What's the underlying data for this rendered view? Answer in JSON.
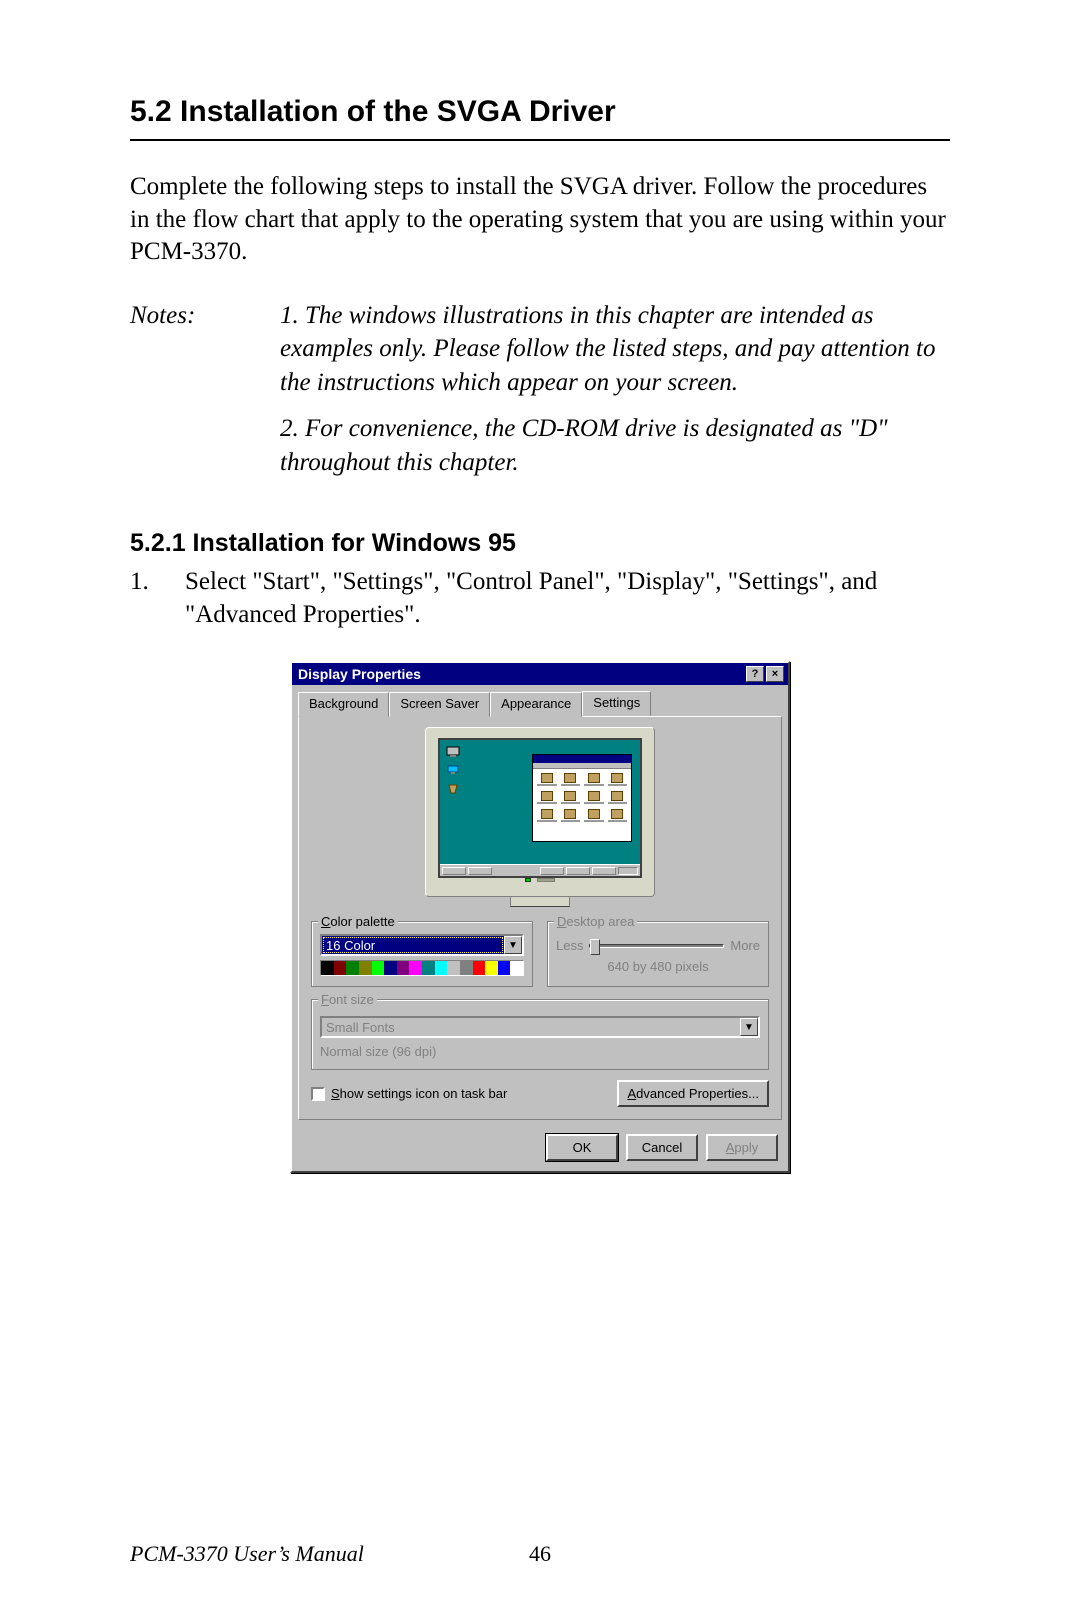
{
  "section": {
    "number": "5.2",
    "title": "5.2  Installation of the SVGA Driver"
  },
  "intro": "Complete the following steps to install the SVGA driver. Follow the procedures in the flow chart that apply to the operating system that you are using within your PCM-3370.",
  "notes": {
    "label": "Notes:",
    "item1": "1.  The windows illustrations in this chapter are intended as examples only. Please follow the listed steps, and pay attention to the instructions which appear on your screen.",
    "item2": "2.  For convenience, the CD-ROM drive is designated as \"D\" throughout this chapter."
  },
  "subsection": {
    "title": "5.2.1 Installation for Windows 95"
  },
  "step1": {
    "num": "1.",
    "text": "Select \"Start\", \"Settings\", \"Control Panel\", \"Display\", \"Settings\", and \"Advanced Properties\"."
  },
  "dialog": {
    "title": "Display Properties",
    "help": "?",
    "close": "×",
    "tabs": {
      "background": "Background",
      "screensaver": "Screen Saver",
      "appearance": "Appearance",
      "settings": "Settings"
    },
    "colorPalette": {
      "legend": "Color palette",
      "value": "16 Color"
    },
    "desktopArea": {
      "legend": "Desktop area",
      "less": "Less",
      "more": "More",
      "resolution": "640 by 480 pixels"
    },
    "fontSize": {
      "legend": "Font size",
      "value": "Small Fonts",
      "normal": "Normal size (96 dpi)"
    },
    "showSettings": "Show settings icon on task bar",
    "advanced": "Advanced Properties...",
    "buttons": {
      "ok": "OK",
      "cancel": "Cancel",
      "apply": "Apply"
    }
  },
  "palette_colors": [
    "#000000",
    "#800000",
    "#008000",
    "#808000",
    "#00ff00",
    "#000080",
    "#800080",
    "#ff00ff",
    "#008080",
    "#00ffff",
    "#c0c0c0",
    "#808080",
    "#ff0000",
    "#ffff00",
    "#0000ff",
    "#ffffff"
  ],
  "footer": {
    "manual": "PCM-3370 User’s Manual",
    "page": "46"
  }
}
